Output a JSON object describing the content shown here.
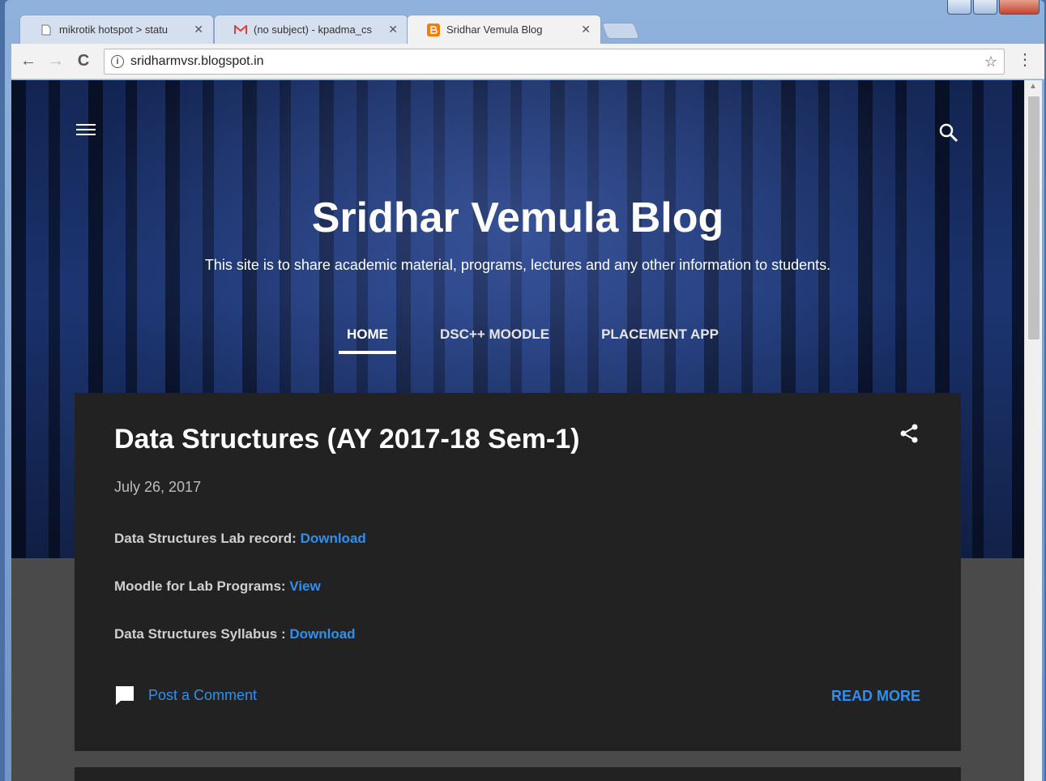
{
  "browser": {
    "tabs": [
      {
        "title": "mikrotik hotspot > statu",
        "icon": "page-icon"
      },
      {
        "title": "(no subject) - kpadma_cs",
        "icon": "gmail-icon"
      },
      {
        "title": "Sridhar Vemula Blog",
        "icon": "blogger-icon"
      }
    ],
    "tab_close": "✕",
    "url": "sridharmvsr.blogspot.in",
    "nav_back": "←",
    "nav_forward": "→",
    "nav_reload": "C",
    "info_glyph": "i",
    "star": "☆",
    "menu": "⋮"
  },
  "blog": {
    "title": "Sridhar Vemula Blog",
    "description": "This site is to share academic material, programs, lectures and any other information to students.",
    "nav": [
      {
        "label": "HOME",
        "active": true
      },
      {
        "label": "DSC++ MOODLE",
        "active": false
      },
      {
        "label": "PLACEMENT APP",
        "active": false
      }
    ]
  },
  "post": {
    "title": "Data Structures (AY 2017-18 Sem-1)",
    "date": "July 26, 2017",
    "lines": [
      {
        "text": "Data Structures Lab record: ",
        "link": "Download"
      },
      {
        "text": "Moodle for Lab Programs: ",
        "link": "View"
      },
      {
        "text": "Data Structures Syllabus : ",
        "link": "Download"
      }
    ],
    "comment_label": "Post a Comment",
    "read_more": "READ MORE"
  },
  "colors": {
    "link": "#2f8ff0",
    "card_bg": "#222222",
    "blogger_orange": "#f57d00",
    "gmail_red": "#d44638"
  }
}
